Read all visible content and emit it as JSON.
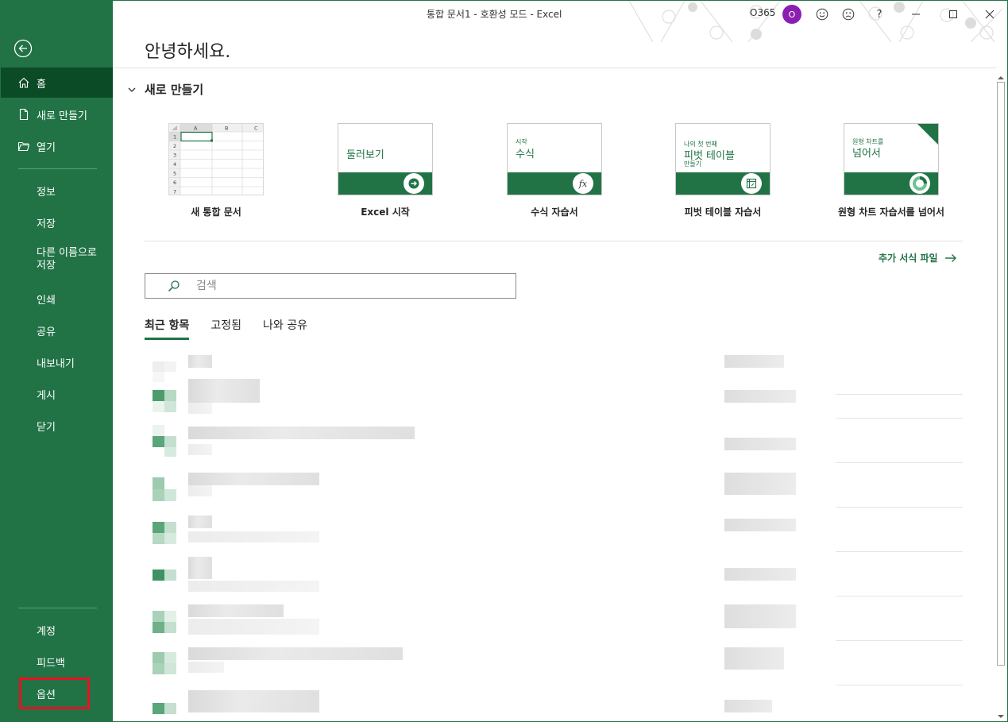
{
  "window": {
    "title": "통합 문서1  -  호환성 모드  -  Excel",
    "user_name": "O365",
    "avatar_initial": "O",
    "help_label": "?"
  },
  "sidebar": {
    "top_items": [
      {
        "label": "홈",
        "icon": "home-icon",
        "active": true
      },
      {
        "label": "새로 만들기",
        "icon": "new-document-icon"
      },
      {
        "label": "열기",
        "icon": "open-folder-icon"
      }
    ],
    "mid_items": [
      "정보",
      "저장",
      "다른 이름으로\n저장",
      "인쇄",
      "공유",
      "내보내기",
      "게시",
      "닫기"
    ],
    "bottom_items": [
      "계정",
      "피드백",
      "옵션"
    ]
  },
  "greeting": "안녕하세요.",
  "new_section": {
    "header": "새로 만들기",
    "templates": [
      {
        "caption": "새 통합 문서",
        "kind": "blank-workbook",
        "grid": {
          "cols": [
            "A",
            "B",
            "C"
          ],
          "rows": [
            "1",
            "2",
            "3",
            "4",
            "5",
            "6",
            "7"
          ]
        }
      },
      {
        "caption": "Excel 시작",
        "kind": "tour",
        "thumb_text": "둘러보기",
        "icon": "arrow-right-icon"
      },
      {
        "caption": "수식 자습서",
        "kind": "formula",
        "thumb_small": "시작",
        "thumb_big": "수식",
        "icon": "fx-icon",
        "icon_text": "fx"
      },
      {
        "caption": "피벗 테이블 자습서",
        "kind": "pivot",
        "thumb_small": "나의 첫 번째",
        "thumb_big": "피벗 테이블",
        "thumb_small2": "만들기",
        "icon": "pivot-table-icon"
      },
      {
        "caption": "원형 차트 자습서를 넘어서",
        "kind": "pie",
        "thumb_small": "원형 차트를",
        "thumb_big": "넘어서",
        "icon": "pie-chart-icon"
      }
    ],
    "more_templates": "추가 서식 파일"
  },
  "search": {
    "placeholder": "검색",
    "value": ""
  },
  "tabs": [
    {
      "label": "최근 항목",
      "active": true
    },
    {
      "label": "고정됨",
      "active": false
    },
    {
      "label": "나와 공유",
      "active": false
    }
  ],
  "recent_files_count_visible": 8,
  "colors": {
    "accent": "#217346",
    "accent_dark": "#0b4b26",
    "highlight": "#e81123",
    "avatar": "#8a1fb1"
  }
}
